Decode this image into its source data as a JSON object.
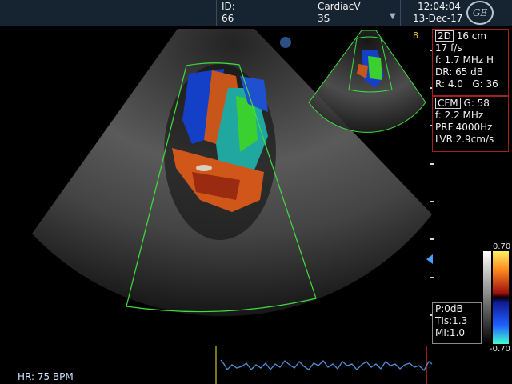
{
  "header": {
    "id_label": "ID:",
    "id_value": "66",
    "preset": "CardiacV",
    "probe": "3S",
    "dropdown_glyph": "▼",
    "time": "12:04:04",
    "date": "13-Dec-17",
    "logo_text": "GE"
  },
  "frame_number": "8",
  "panel_2d": {
    "mode": "2D",
    "depth": "16 cm",
    "frame_rate": "17 f/s",
    "frequency": "f: 1.7 MHz H",
    "dynamic_range": "DR: 65 dB",
    "r_value": "R: 4.0",
    "gain": "G: 36"
  },
  "panel_cfm": {
    "mode": "CFM",
    "gain": "G: 58",
    "frequency": "f: 2.2 MHz",
    "prf": "PRF:4000Hz",
    "lvr": "LVR:2.9cm/s"
  },
  "panel_power": {
    "power": "P:0dB",
    "tis": "TIs:1.3",
    "mi": "MI:1.0"
  },
  "color_bar": {
    "top_value": "0.70",
    "bottom_value": "-0.70"
  },
  "heart_rate": "HR: 75 BPM",
  "colors": {
    "header_bg": "#162330",
    "panel_border": "#a02020",
    "sector_outline": "#3ee03e",
    "ecg_trace": "#4f8fd8"
  },
  "icons": [
    "ge-logo-icon",
    "dropdown-arrow-icon",
    "probe-orientation-dot-icon",
    "depth-pointer-icon"
  ]
}
